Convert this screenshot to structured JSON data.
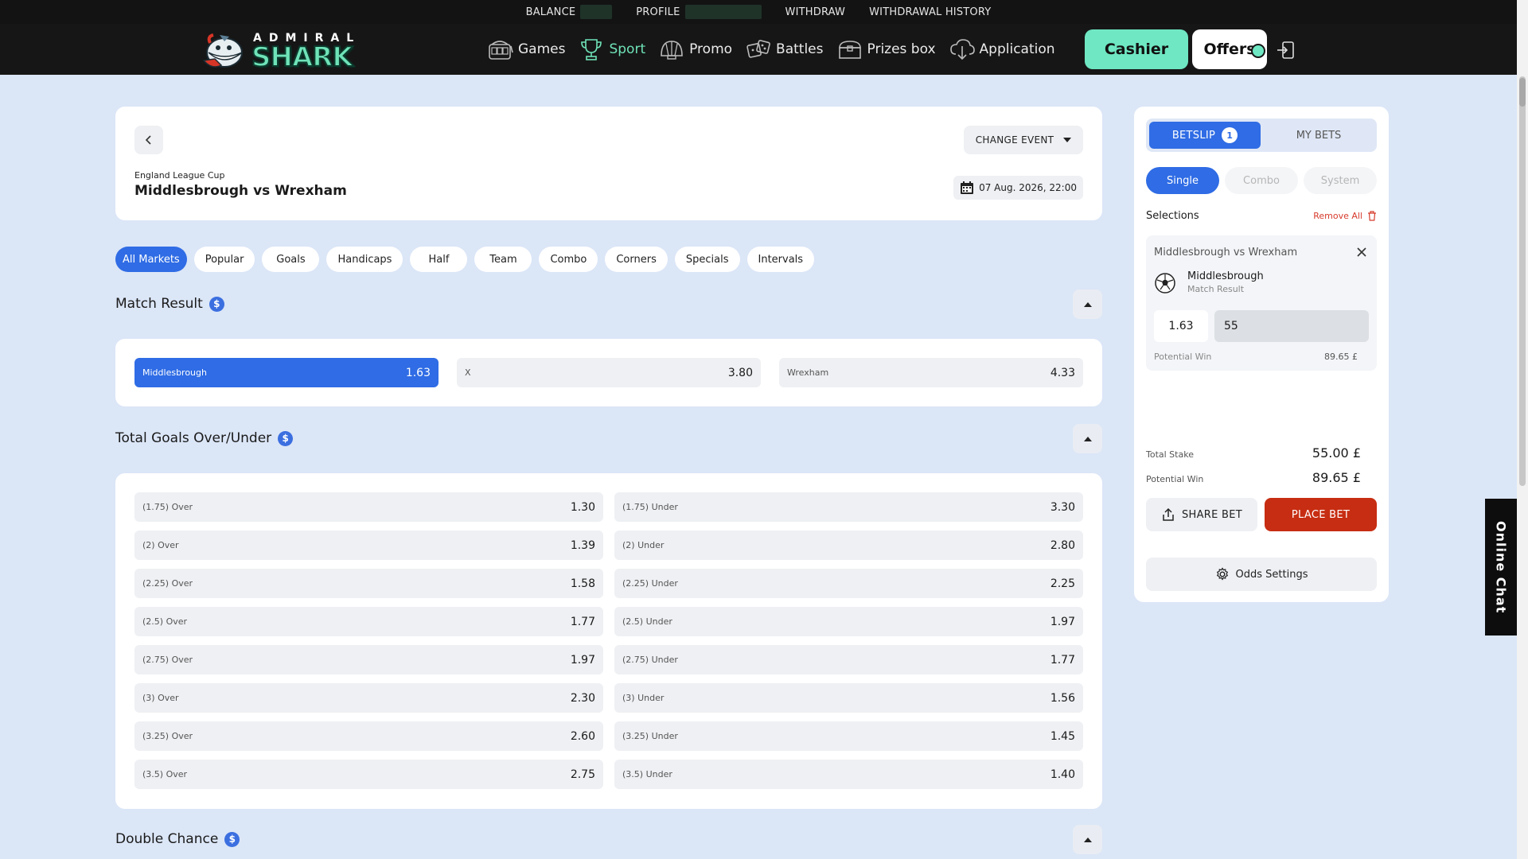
{
  "topbar": {
    "balance_label": "BALANCE",
    "profile_label": "PROFILE",
    "withdraw_label": "WITHDRAW",
    "history_label": "WITHDRAWAL HISTORY"
  },
  "brand": {
    "top": "ADMIRAL",
    "main": "SHARK",
    "accent": "#6fe3b8"
  },
  "nav": {
    "items": [
      {
        "label": "Games",
        "icon": "slot-machine-icon"
      },
      {
        "label": "Sport",
        "icon": "trophy-icon",
        "active": true
      },
      {
        "label": "Promo",
        "icon": "shell-icon"
      },
      {
        "label": "Battles",
        "icon": "dice-icon"
      },
      {
        "label": "Prizes box",
        "icon": "treasure-chest-icon"
      },
      {
        "label": "Application",
        "icon": "cloud-download-icon"
      }
    ],
    "cashier_label": "Cashier",
    "offers_label": "Offers"
  },
  "event": {
    "change_label": "CHANGE EVENT",
    "league": "England League Cup",
    "title": "Middlesbrough vs Wrexham",
    "datetime": "07 Aug. 2026, 22:00"
  },
  "market_tabs": [
    "All Markets",
    "Popular",
    "Goals",
    "Handicaps",
    "Half",
    "Team",
    "Combo",
    "Corners",
    "Specials",
    "Intervals"
  ],
  "markets": {
    "match_result": {
      "title": "Match Result",
      "odds": [
        {
          "label": "Middlesbrough",
          "value": "1.63",
          "selected": true
        },
        {
          "label": "X",
          "value": "3.80"
        },
        {
          "label": "Wrexham",
          "value": "4.33"
        }
      ]
    },
    "total_goals": {
      "title": "Total Goals Over/Under",
      "rows": [
        {
          "over": "(1.75) Over",
          "over_odd": "1.30",
          "under": "(1.75) Under",
          "under_odd": "3.30"
        },
        {
          "over": "(2) Over",
          "over_odd": "1.39",
          "under": "(2) Under",
          "under_odd": "2.80"
        },
        {
          "over": "(2.25) Over",
          "over_odd": "1.58",
          "under": "(2.25) Under",
          "under_odd": "2.25"
        },
        {
          "over": "(2.5) Over",
          "over_odd": "1.77",
          "under": "(2.5) Under",
          "under_odd": "1.97"
        },
        {
          "over": "(2.75) Over",
          "over_odd": "1.97",
          "under": "(2.75) Under",
          "under_odd": "1.77"
        },
        {
          "over": "(3) Over",
          "over_odd": "2.30",
          "under": "(3) Under",
          "under_odd": "1.56"
        },
        {
          "over": "(3.25) Over",
          "over_odd": "2.60",
          "under": "(3.25) Under",
          "under_odd": "1.45"
        },
        {
          "over": "(3.5) Over",
          "over_odd": "2.75",
          "under": "(3.5) Under",
          "under_odd": "1.40"
        }
      ]
    },
    "double_chance": {
      "title": "Double Chance"
    },
    "currency_badge": "$"
  },
  "betslip": {
    "tab_betslip": "BETSLIP",
    "count": "1",
    "tab_mybets": "MY BETS",
    "types": [
      "Single",
      "Combo",
      "System"
    ],
    "selections_label": "Selections",
    "remove_all": "Remove All",
    "item": {
      "event": "Middlesbrough vs Wrexham",
      "team": "Middlesbrough",
      "market": "Match Result",
      "odd": "1.63",
      "stake": "55",
      "potential_label": "Potential Win",
      "potential_value": "89.65 £"
    },
    "total_stake_label": "Total Stake",
    "total_stake_value": "55.00 £",
    "potential_label": "Potential Win",
    "potential_value": "89.65 £",
    "share_label": "SHARE BET",
    "place_label": "PLACE BET",
    "odds_settings_label": "Odds Settings"
  },
  "chat": {
    "label": "Online Chat"
  },
  "colors": {
    "primary": "#2f6ce5",
    "cashier": "#6ee7c2",
    "place_bet": "#c72d12",
    "page_bg": "#dbe6f7"
  }
}
